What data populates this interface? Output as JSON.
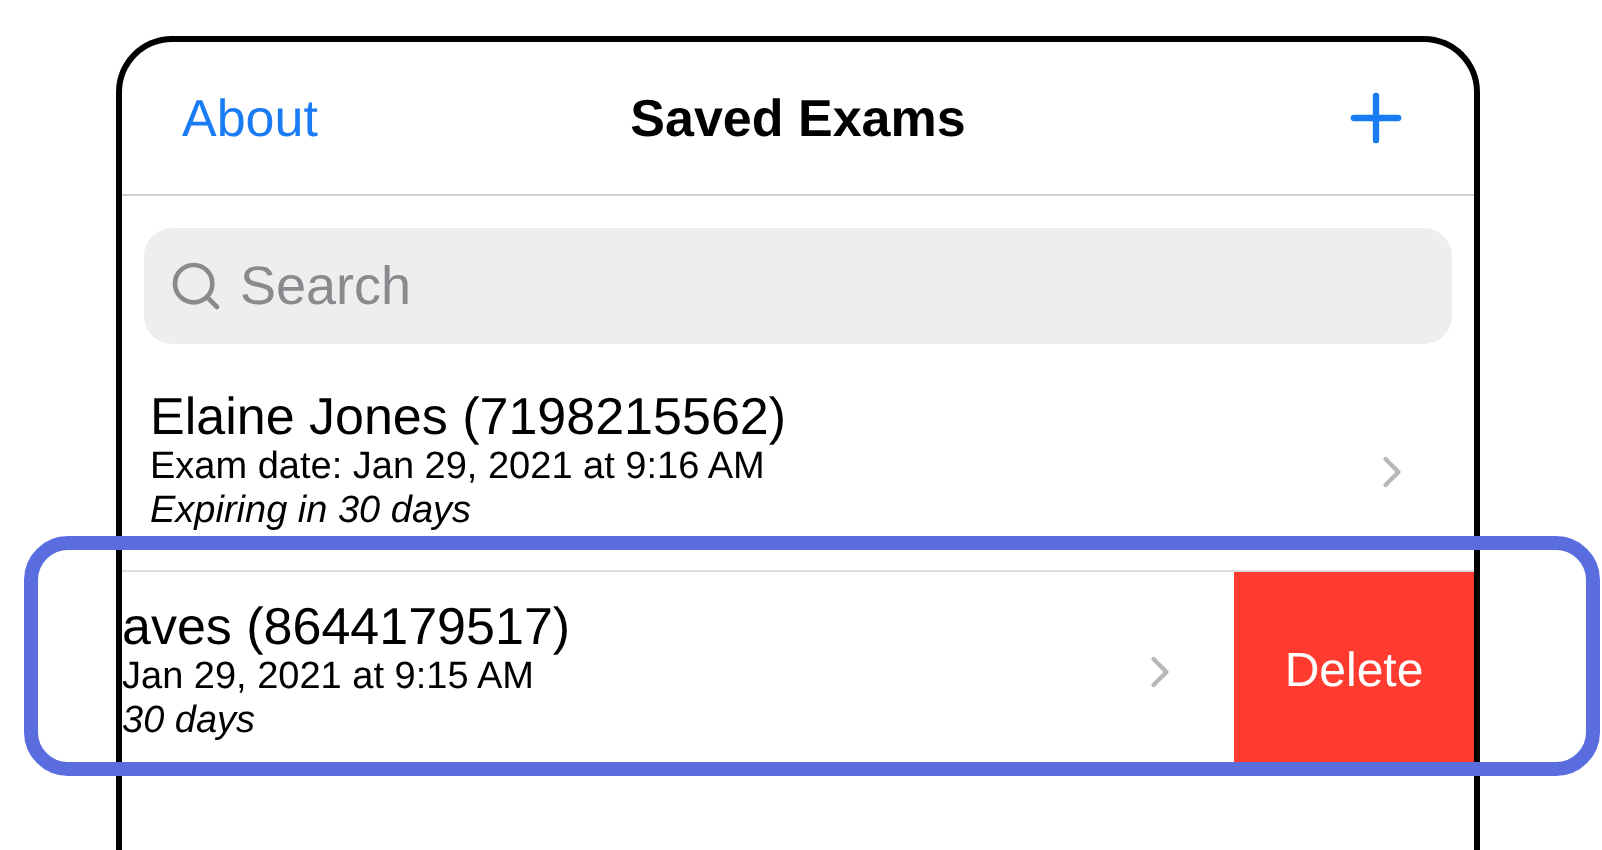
{
  "nav": {
    "left": "About",
    "title": "Saved Exams"
  },
  "search": {
    "placeholder": "Search"
  },
  "rows": [
    {
      "kind": "normal",
      "name": "Elaine Jones (7198215562)",
      "date": "Exam date: Jan 29, 2021 at 9:16 AM",
      "expiry": "Expiring in 30 days"
    },
    {
      "kind": "swiped",
      "name": "aves (8644179517)",
      "date": "Jan 29, 2021 at 9:15 AM",
      "expiry": "30 days",
      "action": "Delete"
    }
  ]
}
